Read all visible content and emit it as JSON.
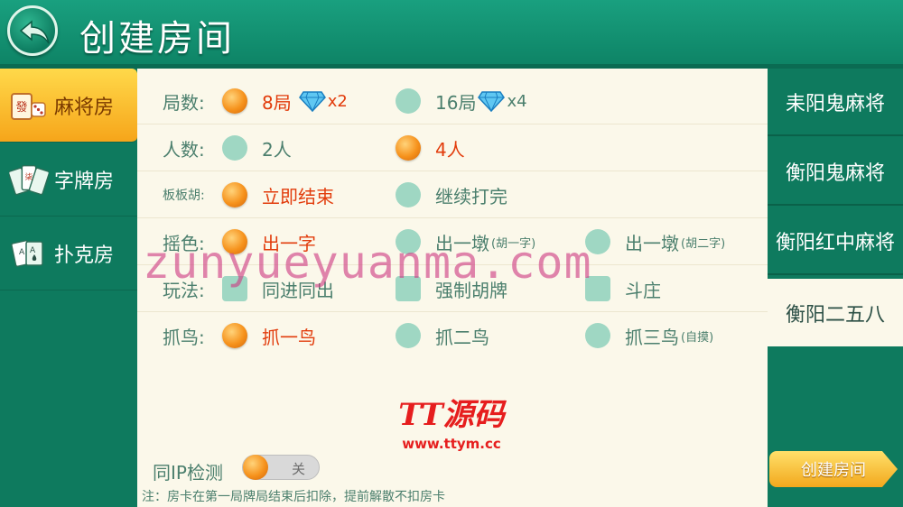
{
  "header": {
    "title": "创建房间"
  },
  "colors": {
    "header_green": "#19a07f",
    "panel_bg": "#fbf8ea",
    "accent_orange": "#f6921c",
    "selected_text": "#e23c0c",
    "label_green": "#4b7f6d"
  },
  "leftnav": {
    "items": [
      {
        "label": "麻将房",
        "icon": "mahjong-tile-icon",
        "active": true
      },
      {
        "label": "字牌房",
        "icon": "zipai-cards-icon",
        "active": false
      },
      {
        "label": "扑克房",
        "icon": "poker-cards-icon",
        "active": false
      }
    ]
  },
  "options": {
    "rounds": {
      "label": "局数:",
      "choices": [
        {
          "text": "8局",
          "gem": "x2",
          "selected": true
        },
        {
          "text": "16局",
          "gem": "x4",
          "selected": false
        }
      ]
    },
    "players": {
      "label": "人数:",
      "choices": [
        {
          "text": "2人",
          "selected": false
        },
        {
          "text": "4人",
          "selected": true
        }
      ]
    },
    "banban": {
      "label": "板板胡:",
      "choices": [
        {
          "text": "立即结束",
          "selected": true
        },
        {
          "text": "继续打完",
          "selected": false
        }
      ]
    },
    "dice": {
      "label": "摇色:",
      "choices": [
        {
          "text": "出一字",
          "sub": "",
          "selected": true
        },
        {
          "text": "出一墩",
          "sub": "(胡一字)",
          "selected": false
        },
        {
          "text": "出一墩",
          "sub": "(胡二字)",
          "selected": false
        }
      ]
    },
    "play": {
      "label": "玩法:",
      "choices": [
        {
          "text": "同进同出",
          "checked": false
        },
        {
          "text": "强制胡牌",
          "checked": false
        },
        {
          "text": "斗庄",
          "checked": false
        }
      ]
    },
    "birds": {
      "label": "抓鸟:",
      "choices": [
        {
          "text": "抓一鸟",
          "sub": "",
          "selected": true
        },
        {
          "text": "抓二鸟",
          "sub": "",
          "selected": false
        },
        {
          "text": "抓三鸟",
          "sub": "(自摸)",
          "selected": false
        }
      ]
    }
  },
  "ip_check": {
    "label": "同IP检测",
    "toggle_text": "关",
    "on": false
  },
  "note": "注：房卡在第一局牌局结束后扣除，提前解散不扣房卡",
  "watermark": "zunyueyuanma.com",
  "logo": {
    "name": "TT源码",
    "url": "www.ttym.cc"
  },
  "rightlist": {
    "items": [
      {
        "label": "耒阳鬼麻将",
        "active": false
      },
      {
        "label": "衡阳鬼麻将",
        "active": false
      },
      {
        "label": "衡阳红中麻将",
        "active": false
      },
      {
        "label": "衡阳二五八",
        "active": true
      }
    ]
  },
  "create_button": {
    "label": "创建房间"
  }
}
